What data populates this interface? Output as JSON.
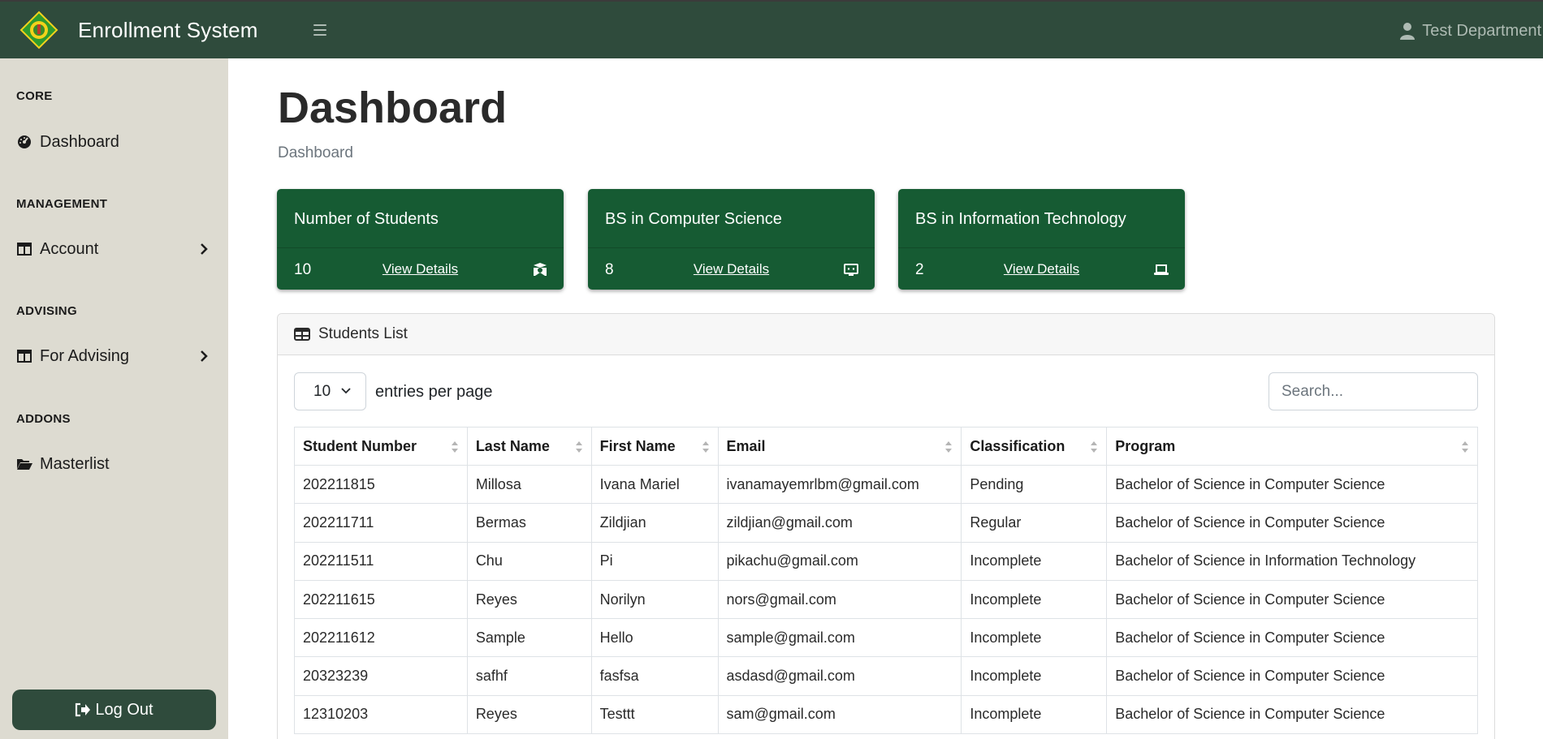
{
  "navbar": {
    "title": "Enrollment System",
    "user_label": "Test Department",
    "logo_colors": {
      "green": "#2e9a2e",
      "yellow": "#f2d21b"
    }
  },
  "sidebar": {
    "sections": [
      {
        "heading": "CORE",
        "items": [
          {
            "label": "Dashboard",
            "icon": "dashboard-gauge-icon",
            "has_submenu": false
          }
        ]
      },
      {
        "heading": "MANAGEMENT",
        "items": [
          {
            "label": "Account",
            "icon": "columns-icon",
            "has_submenu": true
          }
        ]
      },
      {
        "heading": "ADVISING",
        "items": [
          {
            "label": "For Advising",
            "icon": "columns-icon",
            "has_submenu": true
          }
        ]
      },
      {
        "heading": "ADDONS",
        "items": [
          {
            "label": "Masterlist",
            "icon": "folder-open-icon",
            "has_submenu": false
          }
        ]
      }
    ],
    "logout_label": "Log Out"
  },
  "page": {
    "title": "Dashboard",
    "breadcrumb": "Dashboard"
  },
  "cards": [
    {
      "title": "Number of Students",
      "count": "10",
      "link": "View Details",
      "icon": "graduate-user-icon"
    },
    {
      "title": "BS in Computer Science",
      "count": "8",
      "link": "View Details",
      "icon": "computer-screen-icon"
    },
    {
      "title": "BS in Information Technology",
      "count": "2",
      "link": "View Details",
      "icon": "laptop-icon"
    }
  ],
  "students_panel": {
    "title": "Students List",
    "entries_value": "10",
    "entries_label": "entries per page",
    "search_placeholder": "Search...",
    "columns": [
      "Student Number",
      "Last Name",
      "First Name",
      "Email",
      "Classification",
      "Program"
    ],
    "rows": [
      [
        "202211815",
        "Millosa",
        "Ivana Mariel",
        "ivanamayemrlbm@gmail.com",
        "Pending",
        "Bachelor of Science in Computer Science"
      ],
      [
        "202211711",
        "Bermas",
        "Zildjian",
        "zildjian@gmail.com",
        "Regular",
        "Bachelor of Science in Computer Science"
      ],
      [
        "202211511",
        "Chu",
        "Pi",
        "pikachu@gmail.com",
        "Incomplete",
        "Bachelor of Science in Information Technology"
      ],
      [
        "202211615",
        "Reyes",
        "Norilyn",
        "nors@gmail.com",
        "Incomplete",
        "Bachelor of Science in Computer Science"
      ],
      [
        "202211612",
        "Sample",
        "Hello",
        "sample@gmail.com",
        "Incomplete",
        "Bachelor of Science in Computer Science"
      ],
      [
        "20323239",
        "safhf",
        "fasfsa",
        "asdasd@gmail.com",
        "Incomplete",
        "Bachelor of Science in Computer Science"
      ],
      [
        "12310203",
        "Reyes",
        "Testtt",
        "sam@gmail.com",
        "Incomplete",
        "Bachelor of Science in Computer Science"
      ]
    ]
  },
  "colors": {
    "navbar_bg": "#2f4b3c",
    "sidebar_bg": "#dddbd1",
    "card_bg": "#165b33"
  }
}
